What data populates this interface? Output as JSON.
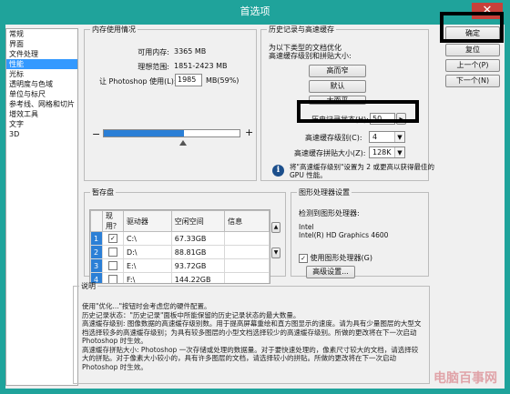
{
  "window": {
    "title": "首选项",
    "close_label": "✕"
  },
  "sidebar": {
    "items": [
      "常规",
      "界面",
      "文件处理",
      "性能",
      "光标",
      "透明度与色域",
      "单位与标尺",
      "参考线、网格和切片",
      "增效工具",
      "文字",
      "3D"
    ],
    "selected_index": 3
  },
  "buttons": {
    "ok": "确定",
    "reset": "复位",
    "prev": "上一个(P)",
    "next": "下一个(N)"
  },
  "memory": {
    "legend": "内存使用情况",
    "available_label": "可用内存:",
    "available_value": "3365 MB",
    "ideal_label": "理想范围:",
    "ideal_value": "1851-2423 MB",
    "let_label": "让 Photoshop 使用(L):",
    "let_value": "1985",
    "let_suffix": "MB(59%)",
    "minus": "−",
    "plus": "+",
    "slider_fraction": 0.59
  },
  "history": {
    "legend": "历史记录与高速缓存",
    "intro": "为以下类型的文档优化\n高速缓存级别和拼贴大小:",
    "btn_tall": "高而窄",
    "btn_default": "默认",
    "btn_big": "大而平",
    "states_label": "历史记录状态(H):",
    "states_value": "50",
    "states_arrow": "▸",
    "cache_levels_label": "高速缓存级别(C):",
    "cache_levels_value": "4",
    "tile_size_label": "高速缓存拼贴大小(Z):",
    "tile_size_value": "128K",
    "info_icon": "i",
    "note": "将\"高速缓存级别\"设置为 2 或更高以获得最佳的\nGPU 性能。"
  },
  "scratch": {
    "legend": "暂存盘",
    "headers": [
      "现用？",
      "驱动器",
      "空闲空间",
      "信息"
    ],
    "rows": [
      {
        "num": "1",
        "active": "✓",
        "drive": "C:\\",
        "free": "67.33GB",
        "info": ""
      },
      {
        "num": "2",
        "active": "",
        "drive": "D:\\",
        "free": "88.81GB",
        "info": ""
      },
      {
        "num": "3",
        "active": "",
        "drive": "E:\\",
        "free": "93.72GB",
        "info": ""
      },
      {
        "num": "4",
        "active": "",
        "drive": "F:\\",
        "free": "144.22GB",
        "info": ""
      }
    ],
    "up": "▲",
    "down": "▼"
  },
  "gpu": {
    "legend": "图形处理器设置",
    "detected_label": "检测到图形处理器:",
    "vendor": "Intel",
    "card": "Intel(R) HD Graphics 4600",
    "use_label": "使用图形处理器(G)",
    "use_checked": "✓",
    "advanced_button": "高级设置..."
  },
  "description": {
    "legend": "说明",
    "lines": [
      "使用\"优化...\"按钮时会考虑您的硬件配置。",
      "历史记录状态：\"历史记录\"面板中所能保留的历史记录状态的最大数量。",
      "高速缓存级别: 图像数据的高速缓存级别数。用于提高屏幕重绘和直方图显示的速度。请为具有少量图层的大型文档选择较多的高速缓存级别；为具有较多图层的小型文档选择较少的高速缓存级别。所做的更改将在下一次启动 Photoshop 时生效。",
      "高速缓存拼贴大小: Photoshop 一次存储或处理的数据量。对于要快速处理的，像素尺寸较大的文档，请选择较大的拼贴。对于像素大小较小的，具有许多图层的文档，请选择较小的拼贴。所做的更改将在下一次启动 Photoshop 时生效。"
    ]
  },
  "watermark": "电脑百事网"
}
